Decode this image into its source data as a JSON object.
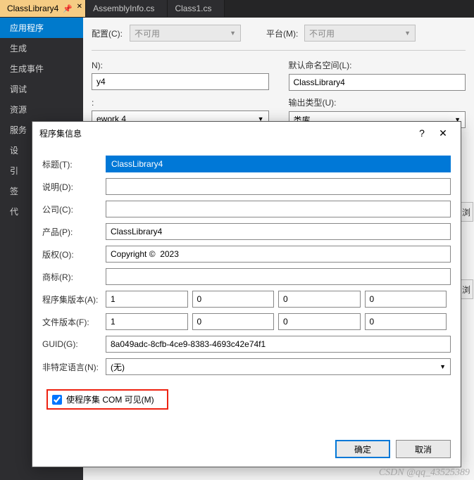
{
  "tabs": [
    {
      "label": "ClassLibrary4",
      "active": true
    },
    {
      "label": "AssemblyInfo.cs",
      "active": false
    },
    {
      "label": "Class1.cs",
      "active": false
    }
  ],
  "sidebar": {
    "items": [
      "应用程序",
      "生成",
      "生成事件",
      "调试",
      "资源",
      "服务",
      "设",
      "引",
      "签",
      "代"
    ],
    "activeIndex": 0
  },
  "app": {
    "config_label": "配置(C):",
    "config_value": "不可用",
    "platform_label": "平台(M):",
    "platform_value": "不可用",
    "name_label": "N):",
    "name_value": "y4",
    "ns_label": "默认命名空间(L):",
    "ns_value": "ClassLibrary4",
    "fw_label": ":",
    "fw_value": "ework 4",
    "outtype_label": "输出类型(U):",
    "outtype_value": "类库",
    "browse_btn": "浏",
    "view_btn": "浏"
  },
  "dialog": {
    "title": "程序集信息",
    "help": "?",
    "close": "✕",
    "fields": {
      "title_label": "标题(T):",
      "title_value": "ClassLibrary4",
      "desc_label": "说明(D):",
      "desc_value": "",
      "company_label": "公司(C):",
      "company_value": "",
      "product_label": "产品(P):",
      "product_value": "ClassLibrary4",
      "copy_label": "版权(O):",
      "copy_value": "Copyright ©  2023",
      "trade_label": "商标(R):",
      "trade_value": "",
      "aver_label": "程序集版本(A):",
      "aver": [
        "1",
        "0",
        "0",
        "0"
      ],
      "fver_label": "文件版本(F):",
      "fver": [
        "1",
        "0",
        "0",
        "0"
      ],
      "guid_label": "GUID(G):",
      "guid_value": "8a049adc-8cfb-4ce9-8383-4693c42e74f1",
      "lang_label": "非特定语言(N):",
      "lang_value": "(无)",
      "com_label": "使程序集 COM 可见(M)",
      "com_checked": true
    },
    "ok": "确定",
    "cancel": "取消"
  },
  "watermark": "CSDN @qq_43525389"
}
